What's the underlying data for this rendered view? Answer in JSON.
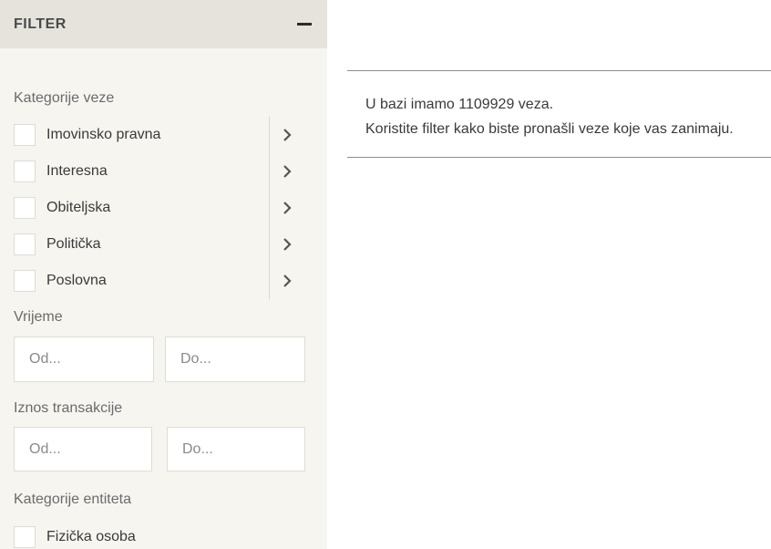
{
  "filter": {
    "title": "FILTER",
    "collapse_icon": "minus-icon"
  },
  "categories": {
    "label": "Kategorije veze",
    "items": [
      {
        "label": "Imovinsko pravna"
      },
      {
        "label": "Interesna"
      },
      {
        "label": "Obiteljska"
      },
      {
        "label": "Politička"
      },
      {
        "label": "Poslovna"
      }
    ],
    "expand_icon": "chevron-right-icon"
  },
  "time": {
    "label": "Vrijeme",
    "from_placeholder": "Od...",
    "to_placeholder": "Do..."
  },
  "amount": {
    "label": "Iznos transakcije",
    "from_placeholder": "Od...",
    "to_placeholder": "Do..."
  },
  "entity_categories": {
    "label": "Kategorije entiteta",
    "items": [
      {
        "label": "Fizička osoba"
      }
    ]
  },
  "main": {
    "line1": "U bazi imamo 1109929 veza.",
    "line2": "Koristite filter kako biste pronašli veze koje vas zanimaju."
  }
}
